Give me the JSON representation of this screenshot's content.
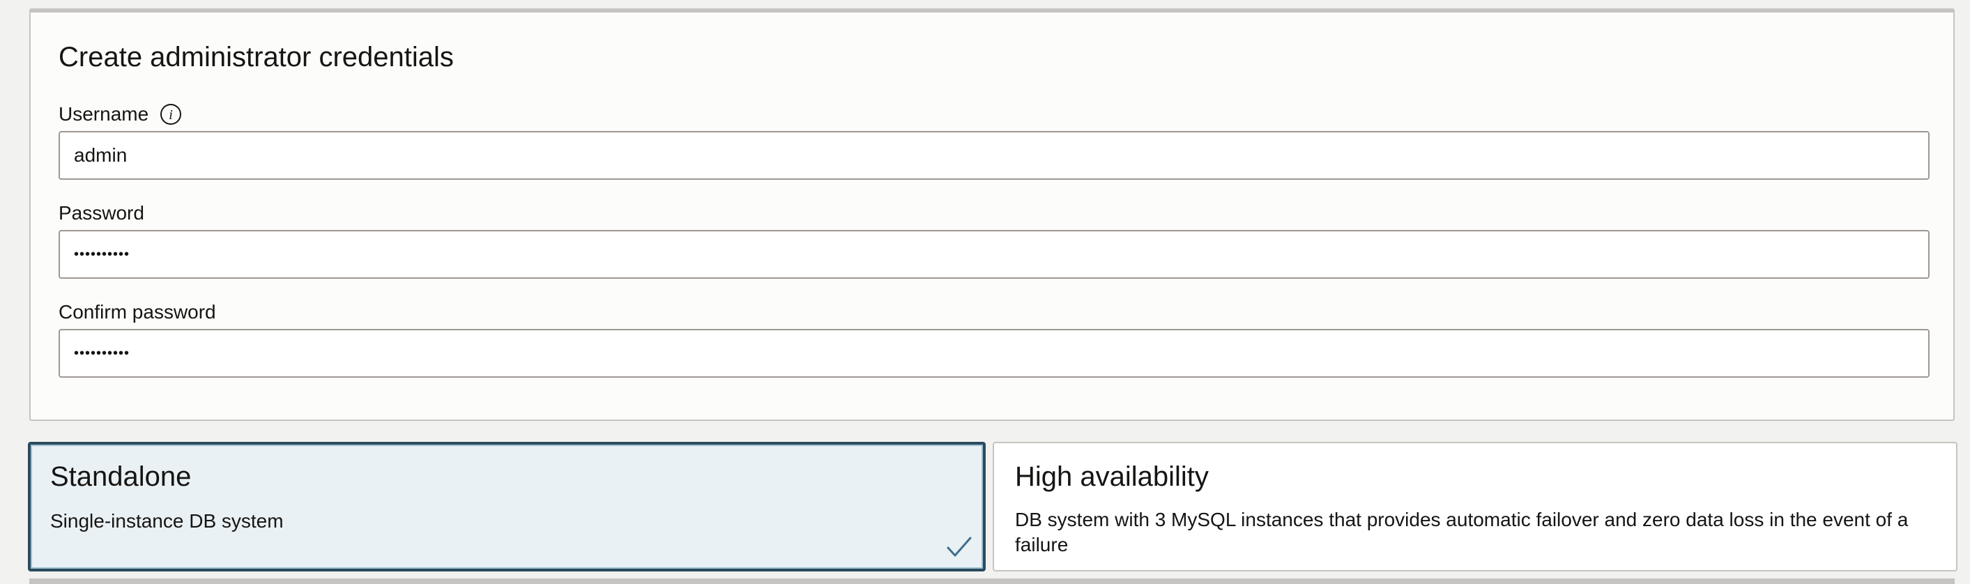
{
  "credentials": {
    "title": "Create administrator credentials",
    "username": {
      "label": "Username",
      "value": "admin"
    },
    "password": {
      "label": "Password",
      "value": "••••••••••"
    },
    "confirm_password": {
      "label": "Confirm password",
      "value": "••••••••••"
    }
  },
  "deployment_options": [
    {
      "title": "Standalone",
      "description": "Single-instance DB system",
      "selected": true
    },
    {
      "title": "High availability",
      "description": "DB system with 3 MySQL instances that provides automatic failover and zero data loss in the event of a failure",
      "selected": false
    }
  ],
  "colors": {
    "selected_border": "#2a4b5e",
    "selected_background": "#e9f1f4",
    "check_color": "#3e6f8e"
  },
  "icons": {
    "username_info": "info-icon",
    "selected_indicator": "checkmark-icon"
  }
}
